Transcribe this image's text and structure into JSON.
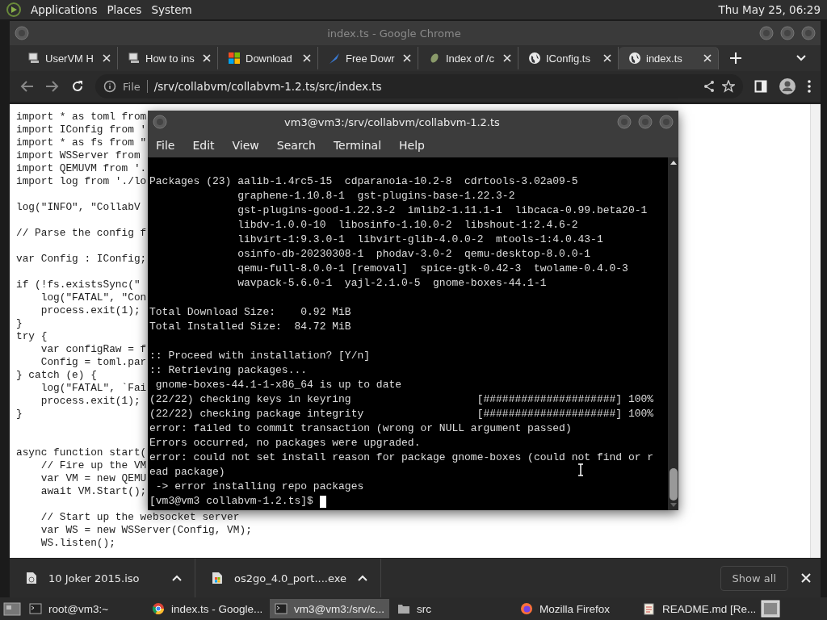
{
  "top_panel": {
    "menus": [
      "Applications",
      "Places",
      "System"
    ],
    "clock": "Thu May 25, 06:29"
  },
  "browser": {
    "title": "index.ts - Google Chrome",
    "tabs": [
      {
        "label": "UserVM H",
        "kind": "computer",
        "selected": false
      },
      {
        "label": "How to ins",
        "kind": "computer",
        "selected": false
      },
      {
        "label": "Download",
        "kind": "windows",
        "selected": false
      },
      {
        "label": "Free Dowr",
        "kind": "feather",
        "selected": false
      },
      {
        "label": "Index of /c",
        "kind": "leaf",
        "selected": false
      },
      {
        "label": "IConfig.ts",
        "kind": "globe",
        "selected": false
      },
      {
        "label": "index.ts",
        "kind": "globe",
        "selected": true
      }
    ],
    "address": {
      "scheme": "File",
      "path": "/srv/collabvm/collabvm-1.2.ts/src/index.ts"
    },
    "code_blocks": [
      [
        "import * as toml from",
        "import IConfig from '",
        "import * as fs from \"",
        "import WSServer from",
        "import QEMUVM from '.",
        "import log from './lo"
      ],
      [
        "log(\"INFO\", \"CollabV"
      ],
      [
        "// Parse the config f"
      ],
      [
        "var Config : IConfig;"
      ],
      [
        "if (!fs.existsSync(\"",
        "    log(\"FATAL\", \"Con",
        "    process.exit(1);",
        "}",
        "try {",
        "    var configRaw = f",
        "    Config = toml.par",
        "} catch (e) {",
        "    log(\"FATAL\", `Fai",
        "    process.exit(1);",
        "}"
      ],
      [
        "async function start(",
        "    // Fire up the VM",
        "    var VM = new QEMU",
        "    await VM.Start();"
      ],
      [
        "    // Start up the websocket server",
        "    var WS = new WSServer(Config, VM);",
        "    WS.listen();"
      ]
    ],
    "downloads": [
      {
        "name": "10 Joker 2015.iso",
        "kind": "disc"
      },
      {
        "name": "os2go_4.0_port....exe",
        "kind": "windows"
      }
    ],
    "show_all": "Show all"
  },
  "terminal": {
    "title": "vm3@vm3:/srv/collabvm/collabvm-1.2.ts",
    "menus": [
      "File",
      "Edit",
      "View",
      "Search",
      "Terminal",
      "Help"
    ],
    "blocks": [
      [
        "Packages (23) aalib-1.4rc5-15  cdparanoia-10.2-8  cdrtools-3.02a09-5",
        "              graphene-1.10.8-1  gst-plugins-base-1.22.3-2",
        "              gst-plugins-good-1.22.3-2  imlib2-1.11.1-1  libcaca-0.99.beta20-1",
        "              libdv-1.0.0-10  libosinfo-1.10.0-2  libshout-1:2.4.6-2",
        "              libvirt-1:9.3.0-1  libvirt-glib-4.0.0-2  mtools-1:4.0.43-1",
        "              osinfo-db-20230308-1  phodav-3.0-2  qemu-desktop-8.0.0-1",
        "              qemu-full-8.0.0-1 [removal]  spice-gtk-0.42-3  twolame-0.4.0-3",
        "              wavpack-5.6.0-1  yajl-2.1.0-5  gnome-boxes-44.1-1"
      ],
      [
        "Total Download Size:    0.92 MiB",
        "Total Installed Size:  84.72 MiB"
      ],
      [
        ":: Proceed with installation? [Y/n]",
        ":: Retrieving packages...",
        " gnome-boxes-44.1-1-x86_64 is up to date",
        "(22/22) checking keys in keyring                    [#####################] 100%",
        "(22/22) checking package integrity                  [#####################] 100%",
        "error: failed to commit transaction (wrong or NULL argument passed)",
        "Errors occurred, no packages were upgraded.",
        "error: could not set install reason for package gnome-boxes (could not find or r",
        "ead package)",
        " -> error installing repo packages"
      ]
    ],
    "prompt": "[vm3@vm3 collabvm-1.2.ts]$"
  },
  "taskbar": [
    {
      "label": "root@vm3:~",
      "kind": "terminal",
      "selected": false
    },
    {
      "label": "index.ts - Google...",
      "kind": "chrome",
      "selected": false
    },
    {
      "label": "vm3@vm3:/srv/c...",
      "kind": "terminal",
      "selected": true
    },
    {
      "label": "src",
      "kind": "folder",
      "selected": false
    },
    {
      "label": "Mozilla Firefox",
      "kind": "firefox",
      "selected": false
    },
    {
      "label": "README.md [Re...",
      "kind": "editor",
      "selected": false
    }
  ]
}
